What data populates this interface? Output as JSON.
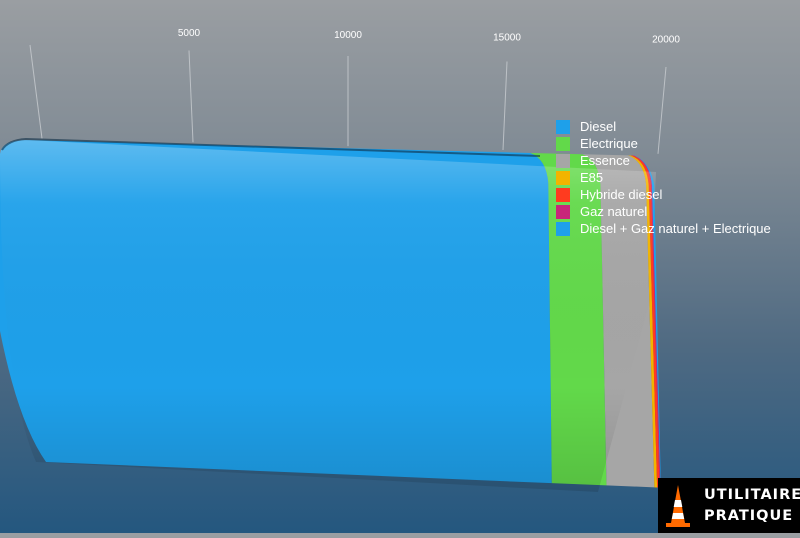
{
  "chart_data": {
    "type": "bar",
    "orientation": "horizontal",
    "stacked": true,
    "three_d": true,
    "ticks": [
      5000,
      10000,
      15000,
      20000
    ],
    "xlim": [
      0,
      21000
    ],
    "series": [
      {
        "name": "Diesel",
        "value": 15900,
        "color": "#1ea0ea"
      },
      {
        "name": "Electrique",
        "value": 1600,
        "color": "#62d94a"
      },
      {
        "name": "Essence",
        "value": 1400,
        "color": "#a6a6a6"
      },
      {
        "name": "E85",
        "value": 80,
        "color": "#f2b400"
      },
      {
        "name": "Hybride diesel",
        "value": 70,
        "color": "#ff3b1f"
      },
      {
        "name": "Gaz naturel",
        "value": 30,
        "color": "#c8267a"
      },
      {
        "name": "Diesel + Gaz naturel + Electrique",
        "value": 10,
        "color": "#1ea0ea"
      }
    ],
    "legend_position": "top-right",
    "grid": true
  },
  "logo": {
    "line1": "UTILITAIRE",
    "line2": "PRATIQUE"
  }
}
